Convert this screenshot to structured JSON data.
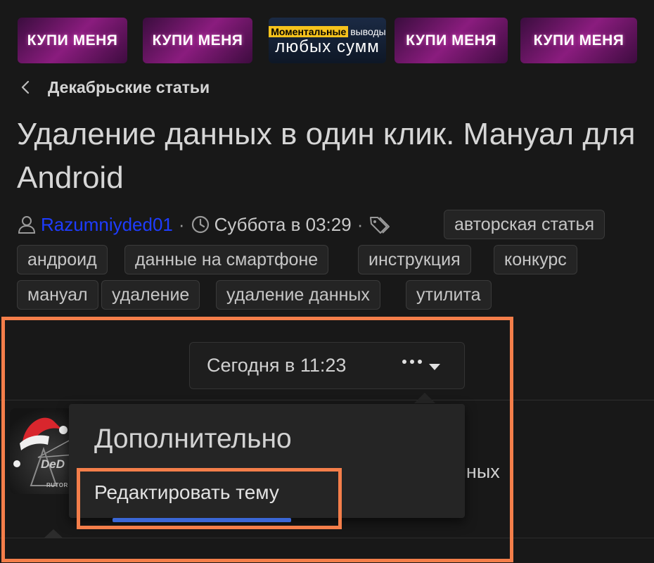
{
  "banners": [
    {
      "type": "buy",
      "text": "КУПИ МЕНЯ"
    },
    {
      "type": "buy",
      "text": "КУПИ МЕНЯ"
    },
    {
      "type": "promo",
      "highlight": "Моментальные",
      "rest": "выводы",
      "bottom": "любых сумм"
    },
    {
      "type": "buy",
      "text": "КУПИ МЕНЯ"
    },
    {
      "type": "buy",
      "text": "КУПИ МЕНЯ"
    }
  ],
  "breadcrumb": {
    "label": "Декабрьские статьи",
    "icon": "chevron-left-icon"
  },
  "article": {
    "title": "Удаление данных в один клик. Мануал для Android",
    "author": "Razumniyded01",
    "separator": "·",
    "datetime": "Суббота в 03:29",
    "tags": [
      "авторская статья",
      "андроид",
      "данные на смартфоне",
      "инструкция",
      "конкурс",
      "мануал",
      "удаление",
      "удаление данных",
      "утилита"
    ]
  },
  "post": {
    "time": "Сегодня в 11:23",
    "avatar_text": "DeD",
    "avatar_subtext": "RUTOR",
    "peek_text": "нных"
  },
  "menu": {
    "header": "Дополнительно",
    "items": [
      "Редактировать тему"
    ]
  },
  "colors": {
    "background": "#181818",
    "author_link": "#1e3cff",
    "annotation": "#f47e4a",
    "banner_magenta": "#8a1c7e",
    "promo_yellow": "#f6c21c",
    "accent_blue": "#3a67d6"
  }
}
